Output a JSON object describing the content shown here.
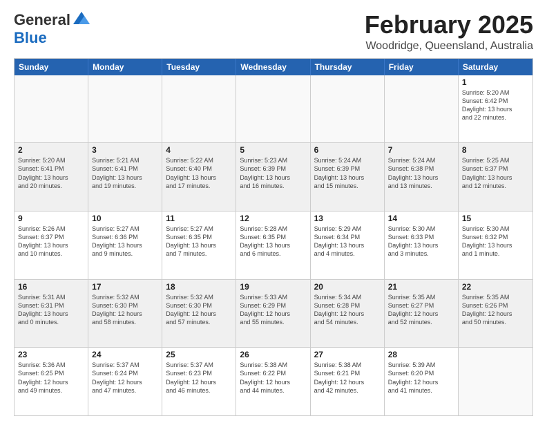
{
  "logo": {
    "general": "General",
    "blue": "Blue"
  },
  "header": {
    "month": "February 2025",
    "location": "Woodridge, Queensland, Australia"
  },
  "weekdays": [
    "Sunday",
    "Monday",
    "Tuesday",
    "Wednesday",
    "Thursday",
    "Friday",
    "Saturday"
  ],
  "rows": [
    {
      "alt": false,
      "cells": [
        {
          "empty": true,
          "day": "",
          "info": ""
        },
        {
          "empty": true,
          "day": "",
          "info": ""
        },
        {
          "empty": true,
          "day": "",
          "info": ""
        },
        {
          "empty": true,
          "day": "",
          "info": ""
        },
        {
          "empty": true,
          "day": "",
          "info": ""
        },
        {
          "empty": true,
          "day": "",
          "info": ""
        },
        {
          "empty": false,
          "day": "1",
          "info": "Sunrise: 5:20 AM\nSunset: 6:42 PM\nDaylight: 13 hours\nand 22 minutes."
        }
      ]
    },
    {
      "alt": true,
      "cells": [
        {
          "empty": false,
          "day": "2",
          "info": "Sunrise: 5:20 AM\nSunset: 6:41 PM\nDaylight: 13 hours\nand 20 minutes."
        },
        {
          "empty": false,
          "day": "3",
          "info": "Sunrise: 5:21 AM\nSunset: 6:41 PM\nDaylight: 13 hours\nand 19 minutes."
        },
        {
          "empty": false,
          "day": "4",
          "info": "Sunrise: 5:22 AM\nSunset: 6:40 PM\nDaylight: 13 hours\nand 17 minutes."
        },
        {
          "empty": false,
          "day": "5",
          "info": "Sunrise: 5:23 AM\nSunset: 6:39 PM\nDaylight: 13 hours\nand 16 minutes."
        },
        {
          "empty": false,
          "day": "6",
          "info": "Sunrise: 5:24 AM\nSunset: 6:39 PM\nDaylight: 13 hours\nand 15 minutes."
        },
        {
          "empty": false,
          "day": "7",
          "info": "Sunrise: 5:24 AM\nSunset: 6:38 PM\nDaylight: 13 hours\nand 13 minutes."
        },
        {
          "empty": false,
          "day": "8",
          "info": "Sunrise: 5:25 AM\nSunset: 6:37 PM\nDaylight: 13 hours\nand 12 minutes."
        }
      ]
    },
    {
      "alt": false,
      "cells": [
        {
          "empty": false,
          "day": "9",
          "info": "Sunrise: 5:26 AM\nSunset: 6:37 PM\nDaylight: 13 hours\nand 10 minutes."
        },
        {
          "empty": false,
          "day": "10",
          "info": "Sunrise: 5:27 AM\nSunset: 6:36 PM\nDaylight: 13 hours\nand 9 minutes."
        },
        {
          "empty": false,
          "day": "11",
          "info": "Sunrise: 5:27 AM\nSunset: 6:35 PM\nDaylight: 13 hours\nand 7 minutes."
        },
        {
          "empty": false,
          "day": "12",
          "info": "Sunrise: 5:28 AM\nSunset: 6:35 PM\nDaylight: 13 hours\nand 6 minutes."
        },
        {
          "empty": false,
          "day": "13",
          "info": "Sunrise: 5:29 AM\nSunset: 6:34 PM\nDaylight: 13 hours\nand 4 minutes."
        },
        {
          "empty": false,
          "day": "14",
          "info": "Sunrise: 5:30 AM\nSunset: 6:33 PM\nDaylight: 13 hours\nand 3 minutes."
        },
        {
          "empty": false,
          "day": "15",
          "info": "Sunrise: 5:30 AM\nSunset: 6:32 PM\nDaylight: 13 hours\nand 1 minute."
        }
      ]
    },
    {
      "alt": true,
      "cells": [
        {
          "empty": false,
          "day": "16",
          "info": "Sunrise: 5:31 AM\nSunset: 6:31 PM\nDaylight: 13 hours\nand 0 minutes."
        },
        {
          "empty": false,
          "day": "17",
          "info": "Sunrise: 5:32 AM\nSunset: 6:30 PM\nDaylight: 12 hours\nand 58 minutes."
        },
        {
          "empty": false,
          "day": "18",
          "info": "Sunrise: 5:32 AM\nSunset: 6:30 PM\nDaylight: 12 hours\nand 57 minutes."
        },
        {
          "empty": false,
          "day": "19",
          "info": "Sunrise: 5:33 AM\nSunset: 6:29 PM\nDaylight: 12 hours\nand 55 minutes."
        },
        {
          "empty": false,
          "day": "20",
          "info": "Sunrise: 5:34 AM\nSunset: 6:28 PM\nDaylight: 12 hours\nand 54 minutes."
        },
        {
          "empty": false,
          "day": "21",
          "info": "Sunrise: 5:35 AM\nSunset: 6:27 PM\nDaylight: 12 hours\nand 52 minutes."
        },
        {
          "empty": false,
          "day": "22",
          "info": "Sunrise: 5:35 AM\nSunset: 6:26 PM\nDaylight: 12 hours\nand 50 minutes."
        }
      ]
    },
    {
      "alt": false,
      "cells": [
        {
          "empty": false,
          "day": "23",
          "info": "Sunrise: 5:36 AM\nSunset: 6:25 PM\nDaylight: 12 hours\nand 49 minutes."
        },
        {
          "empty": false,
          "day": "24",
          "info": "Sunrise: 5:37 AM\nSunset: 6:24 PM\nDaylight: 12 hours\nand 47 minutes."
        },
        {
          "empty": false,
          "day": "25",
          "info": "Sunrise: 5:37 AM\nSunset: 6:23 PM\nDaylight: 12 hours\nand 46 minutes."
        },
        {
          "empty": false,
          "day": "26",
          "info": "Sunrise: 5:38 AM\nSunset: 6:22 PM\nDaylight: 12 hours\nand 44 minutes."
        },
        {
          "empty": false,
          "day": "27",
          "info": "Sunrise: 5:38 AM\nSunset: 6:21 PM\nDaylight: 12 hours\nand 42 minutes."
        },
        {
          "empty": false,
          "day": "28",
          "info": "Sunrise: 5:39 AM\nSunset: 6:20 PM\nDaylight: 12 hours\nand 41 minutes."
        },
        {
          "empty": true,
          "day": "",
          "info": ""
        }
      ]
    }
  ]
}
